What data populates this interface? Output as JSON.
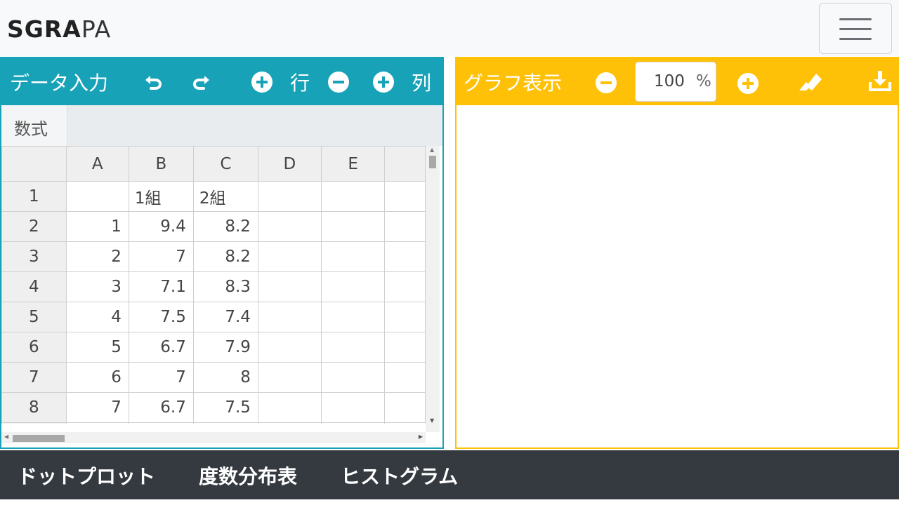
{
  "app": {
    "logo_bold": "SGRA",
    "logo_thin": "PA"
  },
  "left_panel": {
    "title": "データ入力",
    "row_label": "行",
    "col_label": "列",
    "formula_label": "数式"
  },
  "grid": {
    "columns": [
      "A",
      "B",
      "C",
      "D",
      "E"
    ],
    "rows": [
      {
        "n": "1",
        "a": "",
        "b": "1組",
        "c": "2組"
      },
      {
        "n": "2",
        "a": "1",
        "b": "9.4",
        "c": "8.2"
      },
      {
        "n": "3",
        "a": "2",
        "b": "7",
        "c": "8.2"
      },
      {
        "n": "4",
        "a": "3",
        "b": "7.1",
        "c": "8.3"
      },
      {
        "n": "5",
        "a": "4",
        "b": "7.5",
        "c": "7.4"
      },
      {
        "n": "6",
        "a": "5",
        "b": "6.7",
        "c": "7.9"
      },
      {
        "n": "7",
        "a": "6",
        "b": "7",
        "c": "8"
      },
      {
        "n": "8",
        "a": "7",
        "b": "6.7",
        "c": "7.5"
      }
    ]
  },
  "right_panel": {
    "title": "グラフ表示",
    "zoom_value": "100",
    "zoom_unit": "%"
  },
  "tabs": [
    "ドットプロット",
    "度数分布表",
    "ヒストグラム"
  ],
  "colors": {
    "teal": "#17a2b8",
    "yellow": "#ffc107",
    "dark": "#343a40"
  }
}
